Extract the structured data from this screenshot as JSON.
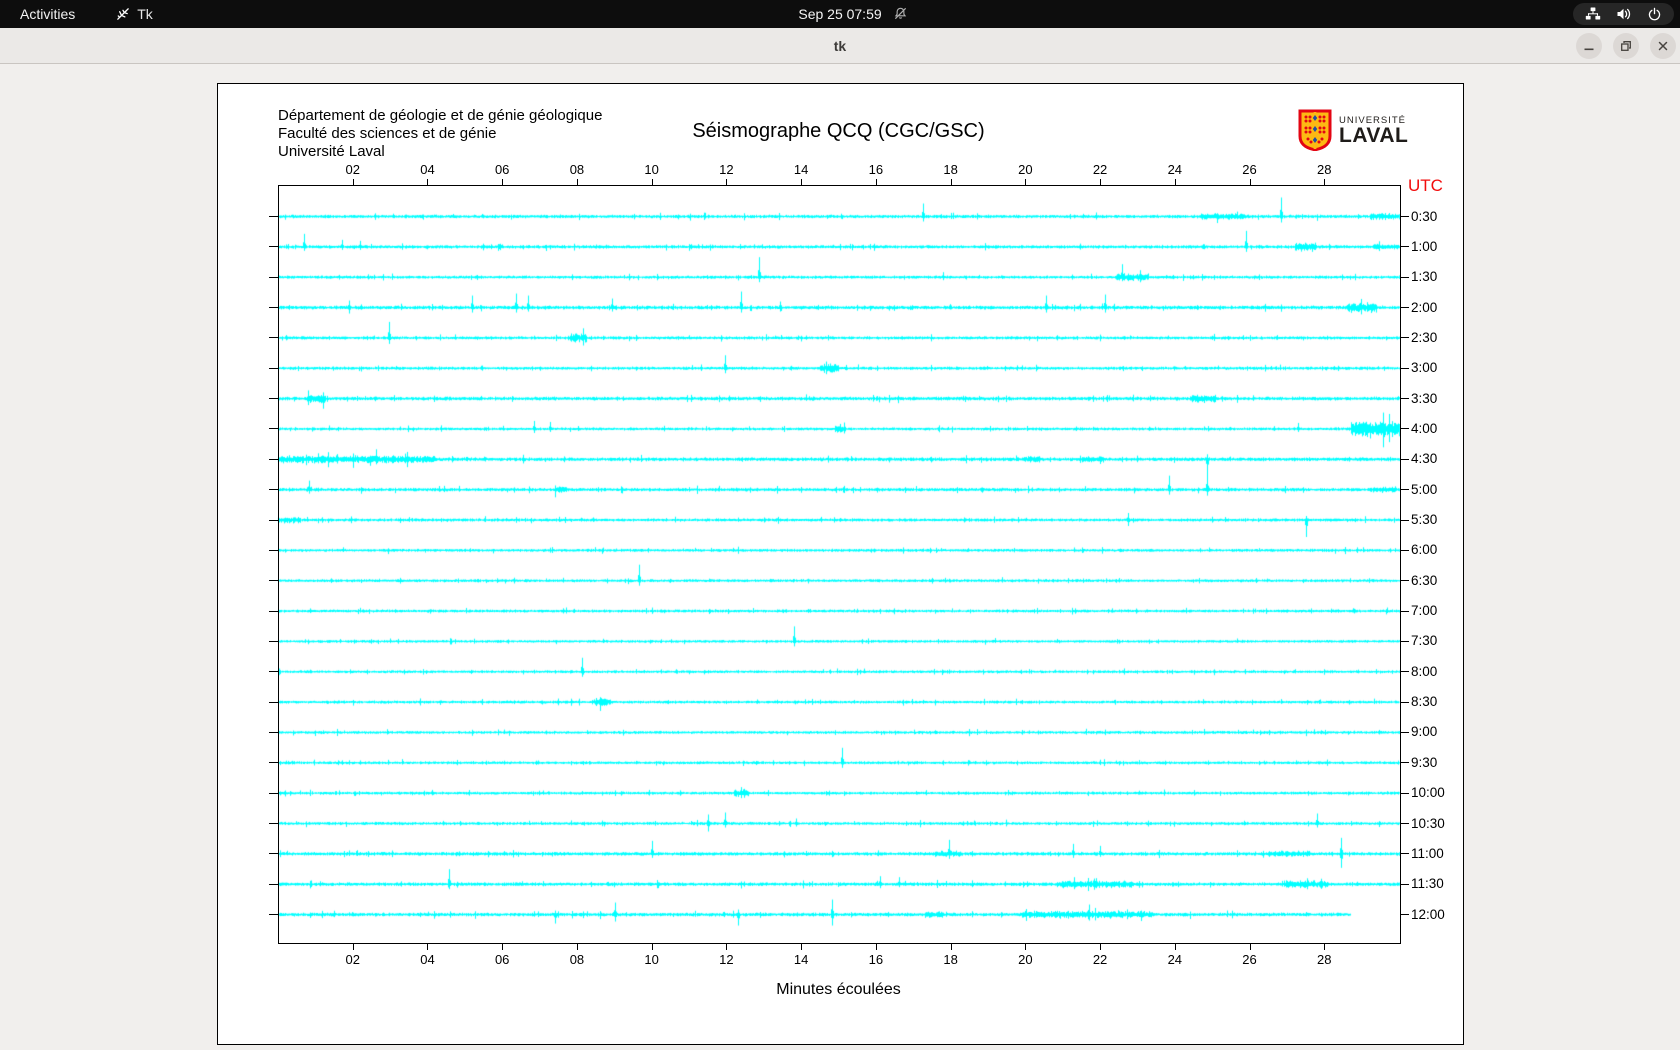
{
  "topbar": {
    "activities": "Activities",
    "app_indicator": "Tk",
    "clock": "Sep 25 07:59",
    "icons": [
      "tk-app-icon",
      "notifications-muted-icon",
      "network-icon",
      "volume-icon",
      "power-icon"
    ]
  },
  "titlebar": {
    "title": "tk",
    "buttons": [
      "minimize",
      "restore",
      "close"
    ]
  },
  "seismograph": {
    "org_lines": [
      "Département de géologie et de génie géologique",
      "Faculté des sciences et de génie",
      "Université Laval"
    ],
    "title": "Séismographe QCQ (CGC/GSC)",
    "logo": {
      "small": "UNIVERSITÉ",
      "big": "LAVAL"
    },
    "utc_label": "UTC",
    "xlabel": "Minutes écoulées",
    "colors": {
      "trace": "#00ffff",
      "utc_red": "#f20d0d",
      "logo_red": "#e30513",
      "logo_gold": "#fdb913",
      "logo_blue": "#1f4ea1"
    },
    "chart_data": {
      "type": "line",
      "description": "24 half-hour helicorder traces, 30 minutes per line",
      "x_minutes_range": [
        0,
        30
      ],
      "x_tick_minutes": [
        2,
        4,
        6,
        8,
        10,
        12,
        14,
        16,
        18,
        20,
        22,
        24,
        26,
        28
      ],
      "x_tick_labels": [
        "02",
        "04",
        "06",
        "08",
        "10",
        "12",
        "14",
        "16",
        "18",
        "20",
        "22",
        "24",
        "26",
        "28"
      ],
      "rows": [
        {
          "label": "0:30",
          "base": 1.1,
          "spikes": [
            [
              17.25,
              13,
              5
            ],
            [
              21.9,
              4,
              3
            ],
            [
              26.85,
              19,
              6
            ]
          ],
          "bursts": [
            [
              24.7,
              25.9,
              2.2
            ],
            [
              29.2,
              30,
              2.2
            ]
          ]
        },
        {
          "label": "1:00",
          "base": 1.1,
          "spikes": [
            [
              0.7,
              13,
              4
            ],
            [
              1.7,
              7,
              3
            ],
            [
              2.2,
              6,
              3
            ],
            [
              25.9,
              16,
              5
            ]
          ],
          "bursts": [
            [
              27.2,
              27.8,
              3
            ],
            [
              29.3,
              30,
              1.9
            ]
          ]
        },
        {
          "label": "1:30",
          "base": 1.0,
          "spikes": [
            [
              12.87,
              20,
              5
            ],
            [
              17.8,
              5,
              3
            ],
            [
              22.6,
              13,
              4
            ]
          ],
          "bursts": [
            [
              22.4,
              23.3,
              2.4
            ]
          ]
        },
        {
          "label": "2:00",
          "base": 1.2,
          "spikes": [
            [
              1.9,
              7,
              6
            ],
            [
              5.2,
              12,
              5
            ],
            [
              6.36,
              14,
              5
            ],
            [
              6.7,
              12,
              4
            ],
            [
              8.94,
              9,
              4
            ],
            [
              12.38,
              16,
              5
            ],
            [
              13.44,
              6,
              4
            ],
            [
              20.55,
              12,
              5
            ],
            [
              22.13,
              13,
              5
            ]
          ],
          "bursts": [
            [
              28.6,
              29.4,
              3.4
            ]
          ]
        },
        {
          "label": "2:30",
          "base": 1.0,
          "spikes": [
            [
              2.97,
              16,
              6
            ],
            [
              25.06,
              4,
              3
            ]
          ],
          "bursts": [
            [
              7.8,
              8.25,
              3
            ]
          ]
        },
        {
          "label": "3:00",
          "base": 1.0,
          "spikes": [
            [
              11.95,
              13,
              5
            ]
          ],
          "bursts": [
            [
              14.5,
              15.0,
              3
            ]
          ]
        },
        {
          "label": "3:30",
          "base": 1.2,
          "spikes": [],
          "bursts": [
            [
              0.76,
              1.28,
              2.8
            ],
            [
              24.4,
              25.1,
              2.5
            ]
          ]
        },
        {
          "label": "4:00",
          "base": 0.95,
          "spikes": [
            [
              6.84,
              8,
              4
            ],
            [
              7.27,
              7,
              3
            ],
            [
              27.3,
              6,
              3
            ]
          ],
          "bursts": [
            [
              14.9,
              15.2,
              2.5
            ],
            [
              28.7,
              30,
              5
            ]
          ]
        },
        {
          "label": "4:30",
          "base": 1.2,
          "spikes": [
            [
              1.08,
              6,
              4
            ],
            [
              2.63,
              10,
              5
            ],
            [
              24.85,
              5,
              15
            ]
          ],
          "bursts": [
            [
              0,
              4.2,
              2.6
            ],
            [
              19.9,
              20.4,
              2.2
            ],
            [
              21.5,
              22.1,
              2.2
            ]
          ]
        },
        {
          "label": "5:00",
          "base": 1.1,
          "spikes": [
            [
              0.82,
              9,
              4
            ],
            [
              23.85,
              14,
              5
            ],
            [
              24.85,
              16,
              6
            ]
          ],
          "bursts": [
            [
              7.4,
              7.7,
              2.5
            ],
            [
              29.2,
              29.9,
              2.2
            ]
          ]
        },
        {
          "label": "5:30",
          "base": 1.0,
          "spikes": [
            [
              22.76,
              7,
              6
            ],
            [
              27.52,
              4,
              17
            ]
          ],
          "bursts": [
            [
              0,
              0.6,
              2.2
            ]
          ]
        },
        {
          "label": "6:00",
          "base": 0.95,
          "spikes": [],
          "bursts": []
        },
        {
          "label": "6:30",
          "base": 0.95,
          "spikes": [
            [
              9.65,
              16,
              5
            ]
          ],
          "bursts": []
        },
        {
          "label": "7:00",
          "base": 0.95,
          "spikes": [],
          "bursts": []
        },
        {
          "label": "7:30",
          "base": 0.9,
          "spikes": [
            [
              13.81,
              15,
              5
            ]
          ],
          "bursts": []
        },
        {
          "label": "8:00",
          "base": 0.9,
          "spikes": [
            [
              8.13,
              14,
              5
            ]
          ],
          "bursts": []
        },
        {
          "label": "8:30",
          "base": 0.95,
          "spikes": [],
          "bursts": [
            [
              8.45,
              8.9,
              2.8
            ]
          ]
        },
        {
          "label": "9:00",
          "base": 0.95,
          "spikes": [],
          "bursts": []
        },
        {
          "label": "9:30",
          "base": 0.95,
          "spikes": [
            [
              15.1,
              15,
              5
            ]
          ],
          "bursts": []
        },
        {
          "label": "10:00",
          "base": 0.95,
          "spikes": [
            [
              12.38,
              6,
              5
            ]
          ],
          "bursts": [
            [
              12.2,
              12.6,
              2.8
            ]
          ]
        },
        {
          "label": "10:30",
          "base": 1.0,
          "spikes": [
            [
              11.52,
              9,
              8
            ],
            [
              11.97,
              11,
              4
            ],
            [
              13.87,
              5,
              3
            ],
            [
              27.81,
              10,
              4
            ]
          ],
          "bursts": []
        },
        {
          "label": "11:00",
          "base": 1.15,
          "spikes": [
            [
              10.0,
              13,
              4
            ],
            [
              17.97,
              14,
              5
            ],
            [
              21.27,
              10,
              4
            ],
            [
              21.99,
              8,
              3
            ],
            [
              28.44,
              16,
              14
            ]
          ],
          "bursts": [
            [
              17.6,
              18.3,
              2
            ],
            [
              26.5,
              27.6,
              2
            ]
          ]
        },
        {
          "label": "11:30",
          "base": 1.15,
          "spikes": [
            [
              4.58,
              15,
              5
            ],
            [
              16.11,
              8,
              4
            ],
            [
              16.62,
              7,
              3
            ],
            [
              21.3,
              7,
              5
            ],
            [
              21.9,
              6,
              4
            ]
          ],
          "bursts": [
            [
              20.9,
              22.9,
              2.4
            ],
            [
              26.9,
              28.1,
              2.4
            ]
          ]
        },
        {
          "label": "12:00",
          "base": 1.2,
          "end": 28.7,
          "spikes": [
            [
              7.4,
              4,
              9
            ],
            [
              9.02,
              12,
              7
            ],
            [
              12.32,
              5,
              11
            ],
            [
              14.82,
              15,
              11
            ],
            [
              21.7,
              10,
              6
            ]
          ],
          "bursts": [
            [
              17.3,
              17.8,
              2.2
            ],
            [
              19.9,
              23.4,
              2.6
            ]
          ]
        }
      ]
    }
  }
}
